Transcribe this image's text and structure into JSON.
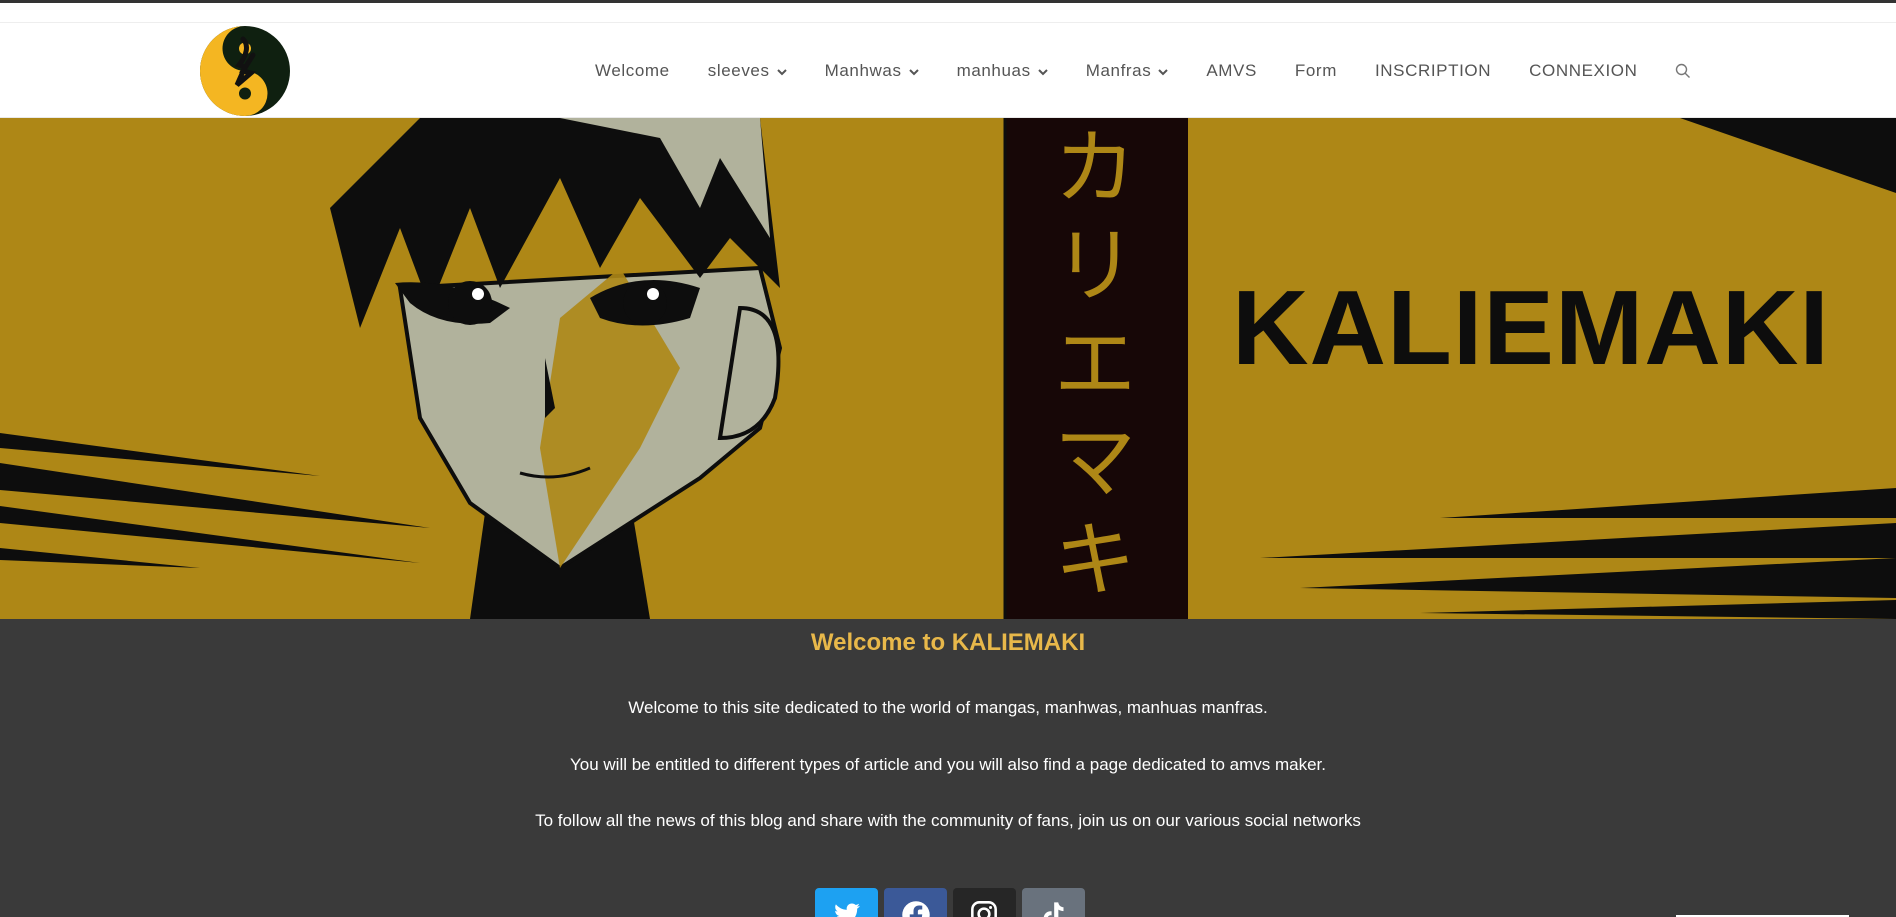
{
  "site": {
    "name": "KALIEMAKI"
  },
  "nav": {
    "items": [
      {
        "label": "Welcome",
        "dropdown": false
      },
      {
        "label": "sleeves",
        "dropdown": true
      },
      {
        "label": "Manhwas",
        "dropdown": true
      },
      {
        "label": "manhuas",
        "dropdown": true
      },
      {
        "label": "Manfras",
        "dropdown": true
      },
      {
        "label": "AMVS",
        "dropdown": false
      },
      {
        "label": "Form",
        "dropdown": false
      },
      {
        "label": "INSCRIPTION",
        "dropdown": false
      },
      {
        "label": "CONNEXION",
        "dropdown": false
      }
    ],
    "search_icon": "search-icon"
  },
  "hero": {
    "brand_text": "KALIEMAKI",
    "katakana": [
      "カ",
      "リ",
      "エ",
      "マ",
      "キ"
    ],
    "colors": {
      "background": "#ae8716",
      "band": "#170707",
      "ink": "#0d0d0d",
      "skin": "#b1b29c"
    }
  },
  "main": {
    "title": "Welcome to KALIEMAKI",
    "paragraphs": [
      "Welcome to this site dedicated to the world of mangas, manhwas, manhuas manfras.",
      "You will be entitled to different types of article and you will also find a page dedicated to amvs maker.",
      "To follow all the news of this blog and share with the community of fans, join us on our various social networks"
    ],
    "colors": {
      "title": "#e8b84a",
      "background": "#3a3a3a",
      "text": "#ffffff"
    }
  },
  "socials": [
    {
      "name": "twitter",
      "icon": "twitter-icon",
      "color": "#1da1f2"
    },
    {
      "name": "facebook",
      "icon": "facebook-icon",
      "color": "#3b5998"
    },
    {
      "name": "instagram",
      "icon": "instagram-icon",
      "color": "#262626"
    },
    {
      "name": "tiktok",
      "icon": "tiktok-icon",
      "color": "#69727d"
    }
  ]
}
